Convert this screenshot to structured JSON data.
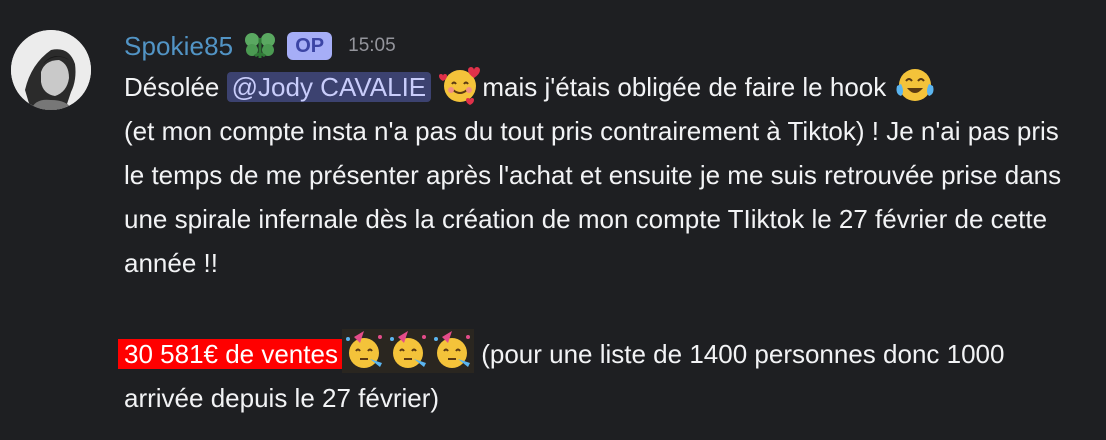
{
  "message": {
    "author": "Spokie85",
    "op_badge": "OP",
    "timestamp": "15:05",
    "line1_before_mention": "Désolée ",
    "mention": "@Jody CAVALIE",
    "line1_after_emoji": "mais j'étais obligée de faire le hook ",
    "paragraph1_rest": "(et mon compte insta n'a pas du tout pris contrairement à Tiktok) ! Je n'ai pas pris le temps de me présenter après l'achat et ensuite je me suis retrouvée prise dans une spirale infernale dès la création de mon compte TIiktok le 27 février de cette année  !!",
    "sales_highlight": "30 581€ de ventes",
    "paragraph2_rest": "(pour une liste de 1400 personnes donc 1000 arrivée depuis le 27 février)"
  },
  "icons": {
    "clan": "clan-badge-icon",
    "emoji1": "smiling-face-with-hearts-emoji",
    "emoji2": "tears-of-joy-emoji",
    "emoji3": "partying-face-emoji"
  },
  "colors": {
    "username": "#5294c5",
    "mention_bg": "#3c4270",
    "highlight": "#ff0000"
  }
}
